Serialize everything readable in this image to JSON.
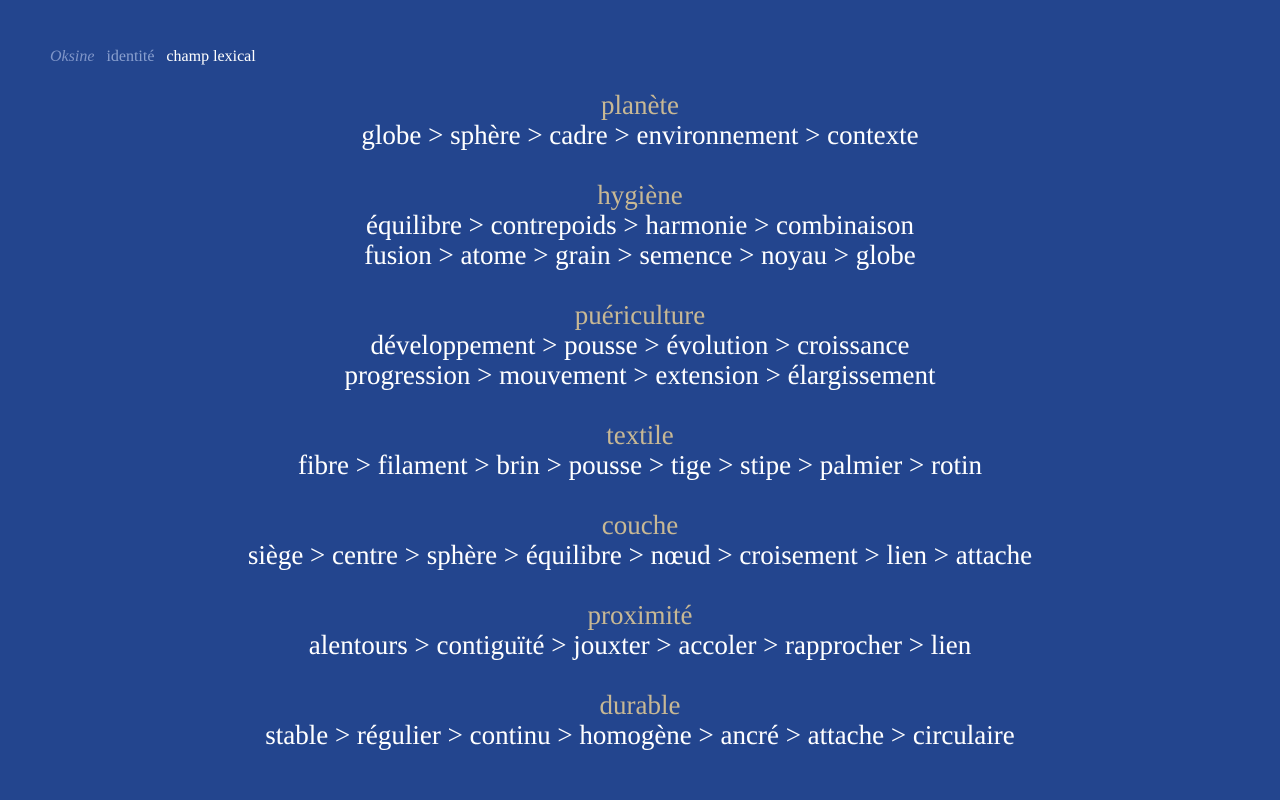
{
  "breadcrumb": {
    "brand": "Oksine",
    "section": "identité",
    "current": "champ lexical"
  },
  "colors": {
    "background": "#23458e",
    "heading": "#c8b894",
    "text": "#ffffff",
    "breadcrumb_muted": "#8aa0cf"
  },
  "groups": [
    {
      "title": "planète",
      "lines": [
        "globe > sphère > cadre > environnement > contexte"
      ]
    },
    {
      "title": "hygiène",
      "lines": [
        "équilibre > contrepoids > harmonie > combinaison",
        "fusion > atome > grain > semence > noyau > globe"
      ]
    },
    {
      "title": "puériculture",
      "lines": [
        "développement > pousse > évolution > croissance",
        "progression > mouvement > extension > élargissement"
      ]
    },
    {
      "title": "textile",
      "lines": [
        "fibre > filament > brin > pousse > tige > stipe > palmier > rotin"
      ]
    },
    {
      "title": "couche",
      "lines": [
        "siège > centre > sphère > équilibre > nœud > croisement > lien > attache"
      ]
    },
    {
      "title": "proximité",
      "lines": [
        "alentours > contiguïté > jouxter > accoler > rapprocher > lien"
      ]
    },
    {
      "title": "durable",
      "lines": [
        "stable > régulier > continu > homogène > ancré > attache > circulaire"
      ]
    }
  ]
}
